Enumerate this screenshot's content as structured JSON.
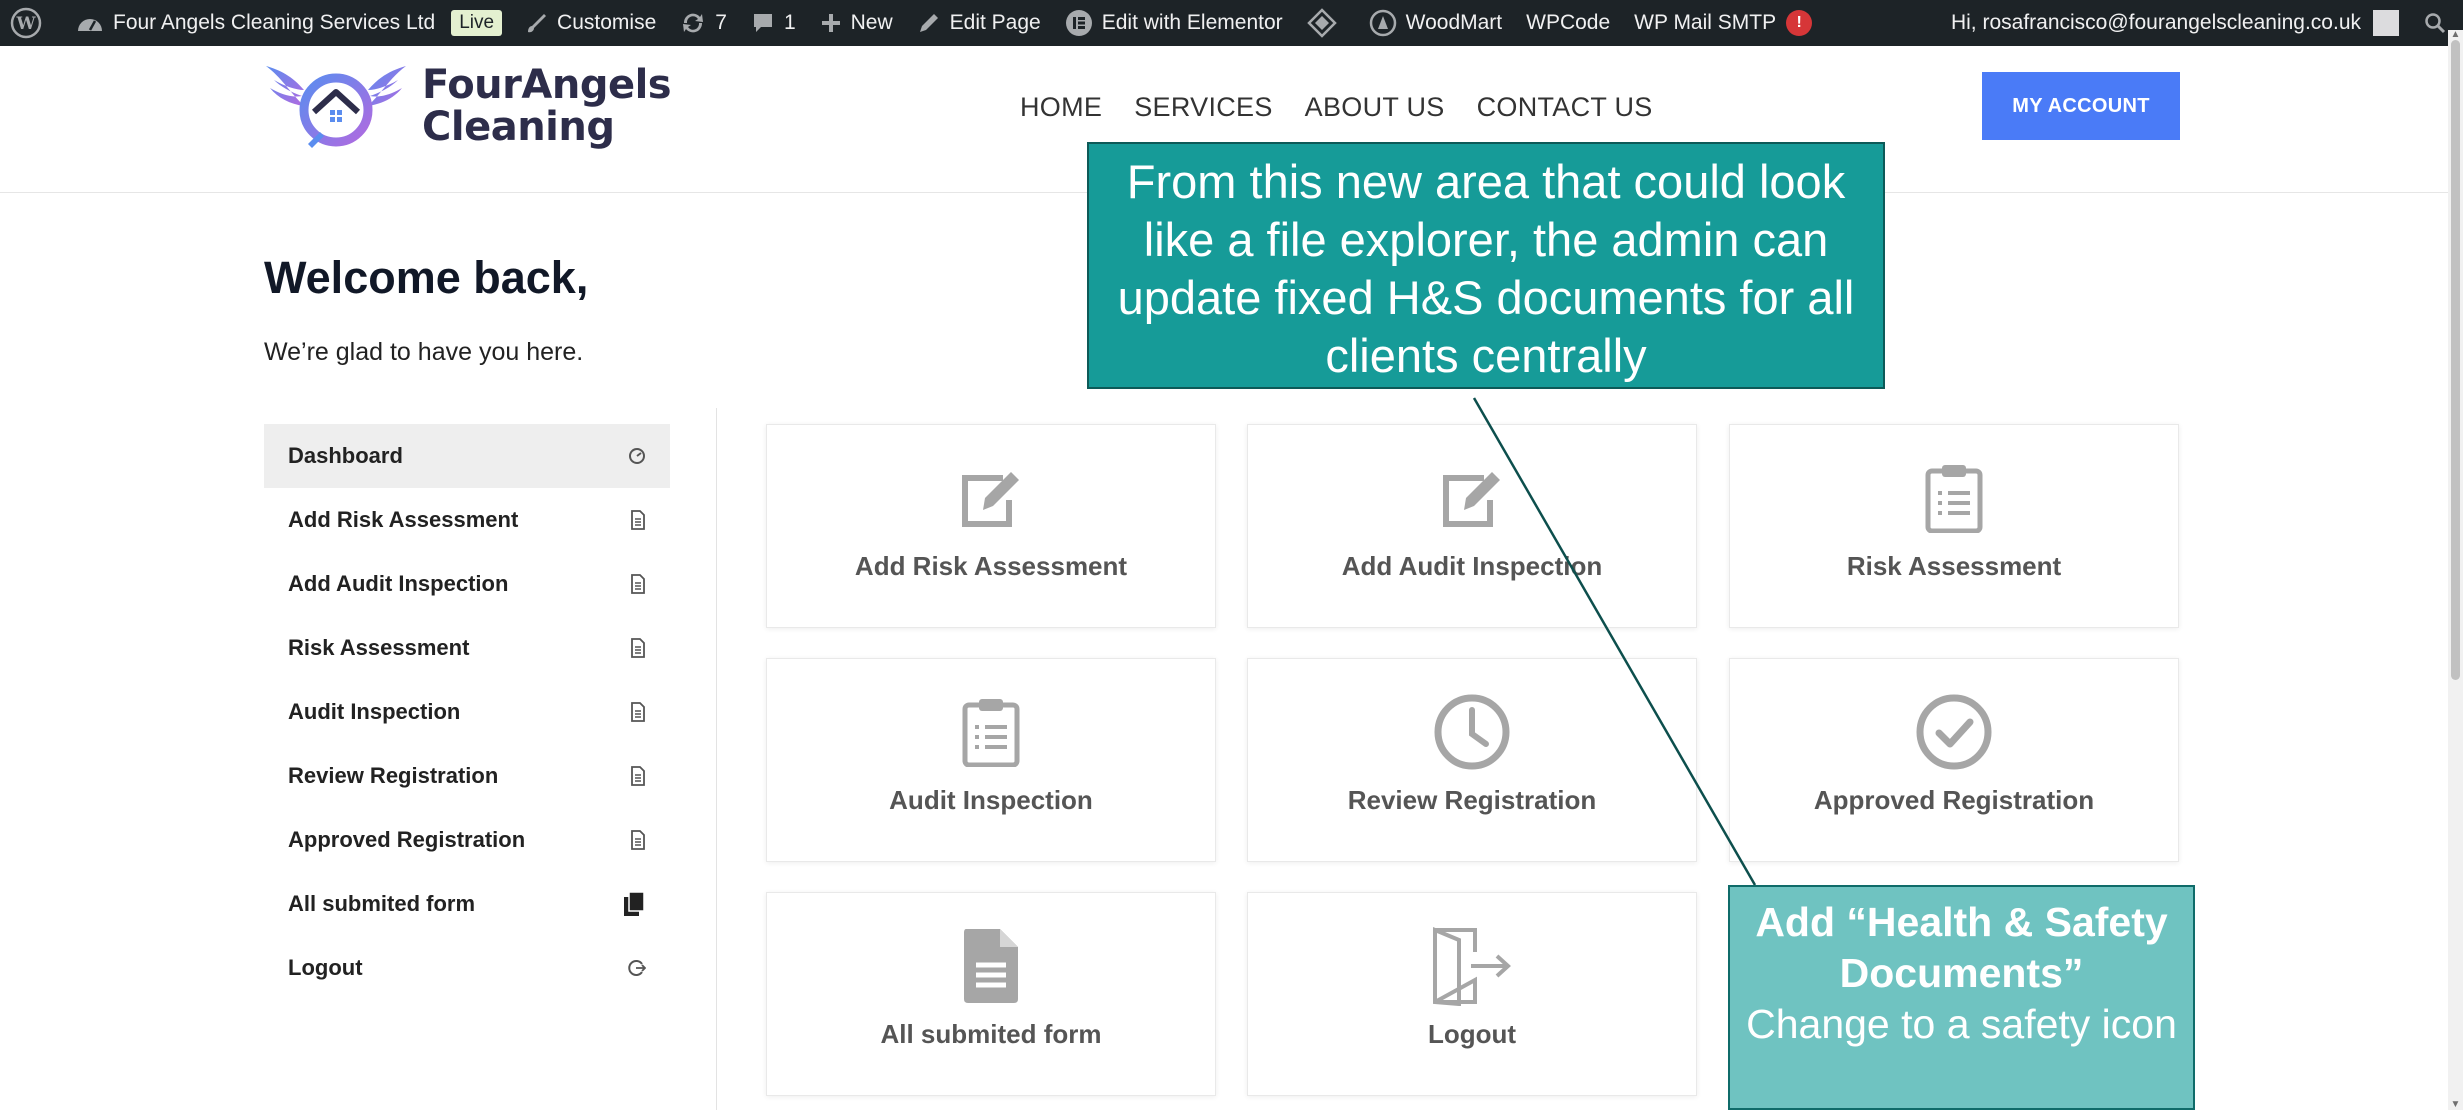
{
  "adminbar": {
    "site_name": "Four Angels Cleaning Services Ltd",
    "live_badge": "Live",
    "customise": "Customise",
    "updates_count": "7",
    "comments_count": "1",
    "new": "New",
    "edit_page": "Edit Page",
    "edit_elementor": "Edit with Elementor",
    "woodmart": "WoodMart",
    "wpcode": "WPCode",
    "wp_mail_smtp": "WP Mail SMTP",
    "smtp_alert": "!",
    "greeting": "Hi, rosafrancisco@fourangelscleaning.co.uk"
  },
  "header": {
    "logo_line1": "FourAngels",
    "logo_line2": "Cleaning",
    "nav": [
      "HOME",
      "SERVICES",
      "ABOUT US",
      "CONTACT US"
    ],
    "account_button": "MY ACCOUNT",
    "brand_color": "#4a7bf7"
  },
  "welcome": {
    "title": "Welcome back,",
    "subtitle": "We’re glad to have you here."
  },
  "sidebar": {
    "items": [
      {
        "label": "Dashboard",
        "icon": "gauge-icon"
      },
      {
        "label": "Add Risk Assessment",
        "icon": "document-icon"
      },
      {
        "label": "Add Audit Inspection",
        "icon": "document-icon"
      },
      {
        "label": "Risk Assessment",
        "icon": "document-icon"
      },
      {
        "label": "Audit Inspection",
        "icon": "document-icon"
      },
      {
        "label": "Review Registration",
        "icon": "document-icon"
      },
      {
        "label": "Approved Registration",
        "icon": "document-icon"
      },
      {
        "label": "All submited form",
        "icon": "copy-icon"
      },
      {
        "label": "Logout",
        "icon": "logout-icon"
      }
    ]
  },
  "cards": [
    {
      "label": "Add Risk Assessment",
      "icon": "edit-icon"
    },
    {
      "label": "Add Audit Inspection",
      "icon": "edit-icon"
    },
    {
      "label": "Risk Assessment",
      "icon": "clipboard-icon"
    },
    {
      "label": "Audit Inspection",
      "icon": "clipboard-icon"
    },
    {
      "label": "Review Registration",
      "icon": "clock-icon"
    },
    {
      "label": "Approved Registration",
      "icon": "check-circle-icon"
    },
    {
      "label": "All submited form",
      "icon": "file-icon"
    },
    {
      "label": "Logout",
      "icon": "logout-door-icon"
    }
  ],
  "annotations": {
    "top": "From this new area that could look like a file explorer, the admin can update fixed H&S documents for all clients centrally",
    "bottom_heading": "Add “Health & Safety Documents”",
    "bottom_body": "Change to a safety icon",
    "top_color": "#169b98",
    "bottom_color": "#6fc3c1"
  }
}
